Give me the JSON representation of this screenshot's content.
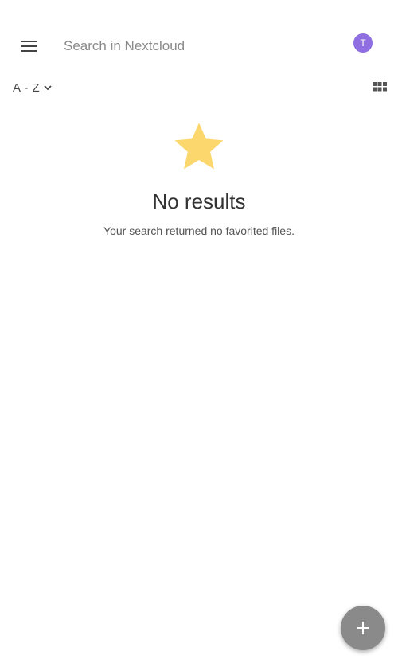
{
  "search": {
    "placeholder": "Search in Nextcloud",
    "value": ""
  },
  "user": {
    "avatar_initial": "T",
    "avatar_color": "#8e6ee0"
  },
  "sort": {
    "label": "A - Z"
  },
  "empty_state": {
    "title": "No results",
    "message": "Your search returned no favorited files.",
    "icon": "star-icon",
    "icon_color": "#fbd76e"
  },
  "fab": {
    "icon": "plus-icon",
    "color": "#8a8a8a"
  },
  "icons": {
    "menu": "menu-icon",
    "view_toggle": "grid-view-icon",
    "sort_chevron": "chevron-down-icon"
  }
}
